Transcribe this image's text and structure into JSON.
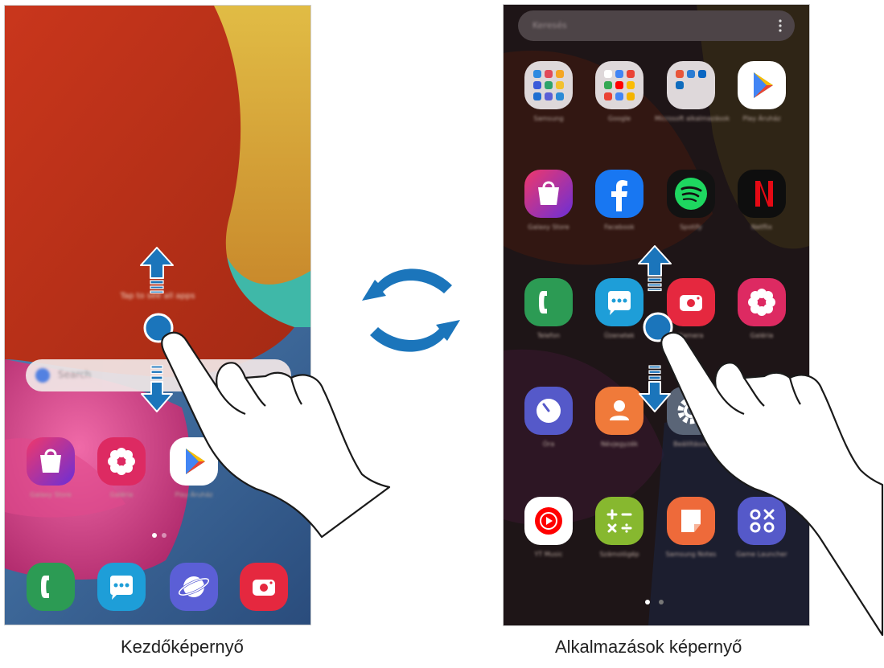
{
  "captions": {
    "home": "Kezdőképernyő",
    "apps": "Alkalmazások képernyő"
  },
  "home": {
    "hint_text": "Tap to see all apps",
    "search_placeholder": "Search",
    "app_labels": [
      "Galaxy Store",
      "Galéria",
      "Play Áruház"
    ]
  },
  "apps": {
    "search_placeholder": "Keresés",
    "app_labels": [
      "Samsung",
      "Google",
      "Microsoft alkalmazások",
      "Play Áruház",
      "Galaxy Store",
      "Facebook",
      "Spotify",
      "Netflix",
      "Telefon",
      "Üzenetek",
      "Kamera",
      "Galéria",
      "Óra",
      "Névjegyzék",
      "Beállítások",
      "",
      "YT Music",
      "Számológép",
      "Samsung Notes",
      "Game Launcher"
    ]
  },
  "colors": {
    "accent": "#1b75bb"
  },
  "icons": {
    "home_row": [
      "galaxy-store-icon",
      "gallery-icon",
      "play-store-icon"
    ],
    "home_dock": [
      "phone-icon",
      "messages-icon",
      "internet-icon",
      "camera-icon"
    ],
    "apps_grid": [
      "samsung-folder-icon",
      "google-folder-icon",
      "microsoft-folder-icon",
      "play-store-icon",
      "galaxy-store-icon",
      "facebook-icon",
      "spotify-icon",
      "netflix-icon",
      "phone-icon",
      "messages-icon",
      "camera-icon",
      "gallery-icon",
      "clock-icon",
      "contacts-icon",
      "settings-icon",
      "yt-music-icon",
      "calculator-icon",
      "samsung-notes-icon",
      "game-launcher-icon"
    ]
  }
}
